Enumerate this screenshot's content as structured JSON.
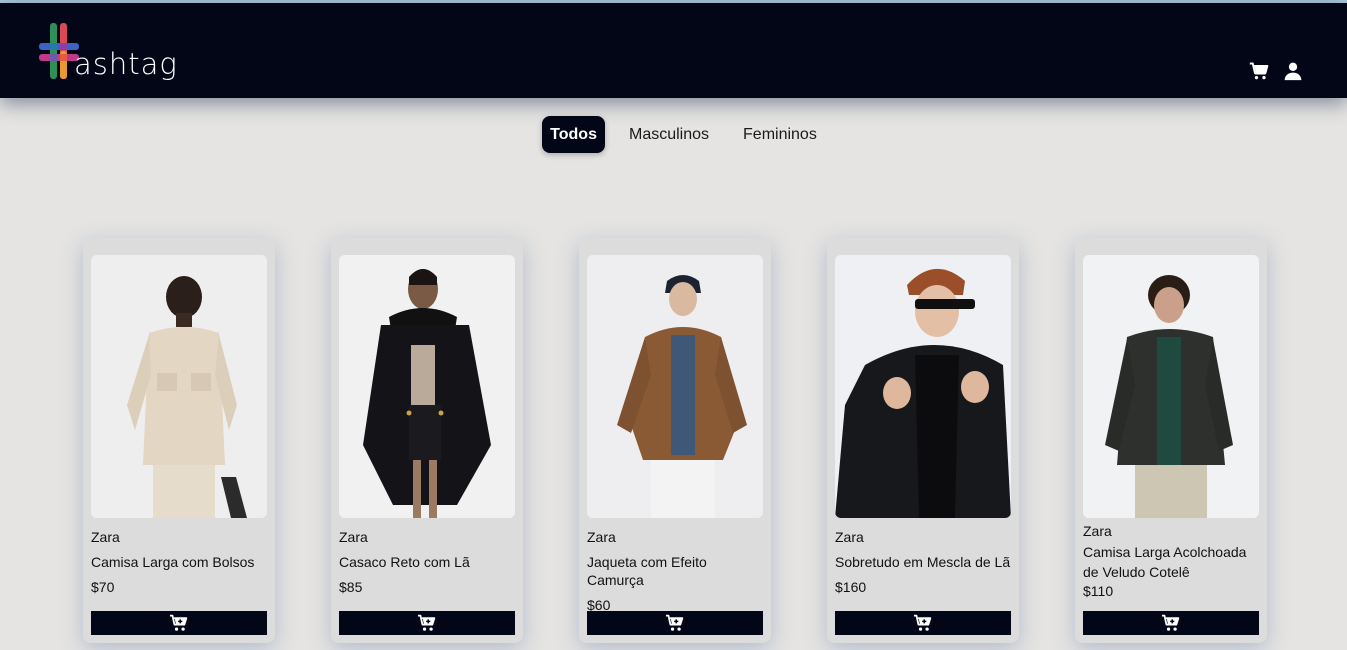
{
  "header": {
    "logo_text": "ashtag",
    "icons": [
      "cart-icon",
      "user-icon"
    ]
  },
  "filters": [
    {
      "label": "Todos",
      "active": true
    },
    {
      "label": "Masculinos",
      "active": false
    },
    {
      "label": "Femininos",
      "active": false
    }
  ],
  "products": [
    {
      "brand": "Zara",
      "name": "Camisa Larga com Bolsos",
      "price": "$70",
      "photo": "model-cream-overshirt"
    },
    {
      "brand": "Zara",
      "name": "Casaco Reto com Lã",
      "price": "$85",
      "photo": "model-black-fur-coat"
    },
    {
      "brand": "Zara",
      "name": "Jaqueta com Efeito Camurça",
      "price": "$60",
      "photo": "model-brown-suede-jacket"
    },
    {
      "brand": "Zara",
      "name": "Sobretudo em Mescla de Lã",
      "price": "$160",
      "photo": "model-black-overcoat"
    },
    {
      "brand": "Zara",
      "name": "Camisa Larga Acolchoada de Veludo Cotelê",
      "price": "$110",
      "photo": "model-dark-corduroy-shirt"
    }
  ],
  "colors": {
    "header_bg": "#030617",
    "page_bg": "#e5e4e2",
    "card_bg": "#dcdcdc",
    "button_bg": "#030617"
  }
}
